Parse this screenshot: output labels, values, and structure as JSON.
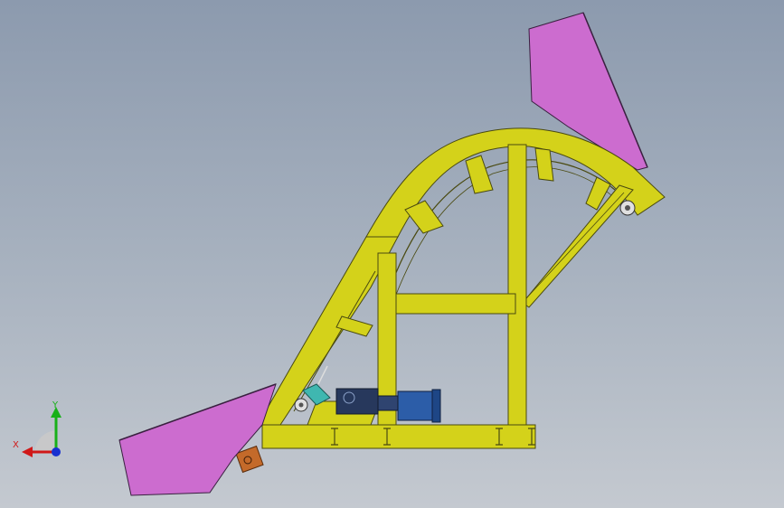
{
  "viewport": {
    "background_top": "#8c9aae",
    "background_bottom": "#c4c9d0"
  },
  "colors": {
    "frame": "#d4d21a",
    "frame_edge": "#4a4a10",
    "hopper": "#cc6ccf",
    "hopper_edge": "#3a2040",
    "motor": "#2c5da8",
    "gearbox": "#27385c",
    "tensioner": "#3fb7b0",
    "bearing": "#c46a2a",
    "pulley": "#cfcfcf"
  },
  "triad": {
    "x_label": "X",
    "y_label": "Y",
    "x_color": "#d01818",
    "y_color": "#18b018",
    "z_color": "#1830d0"
  }
}
